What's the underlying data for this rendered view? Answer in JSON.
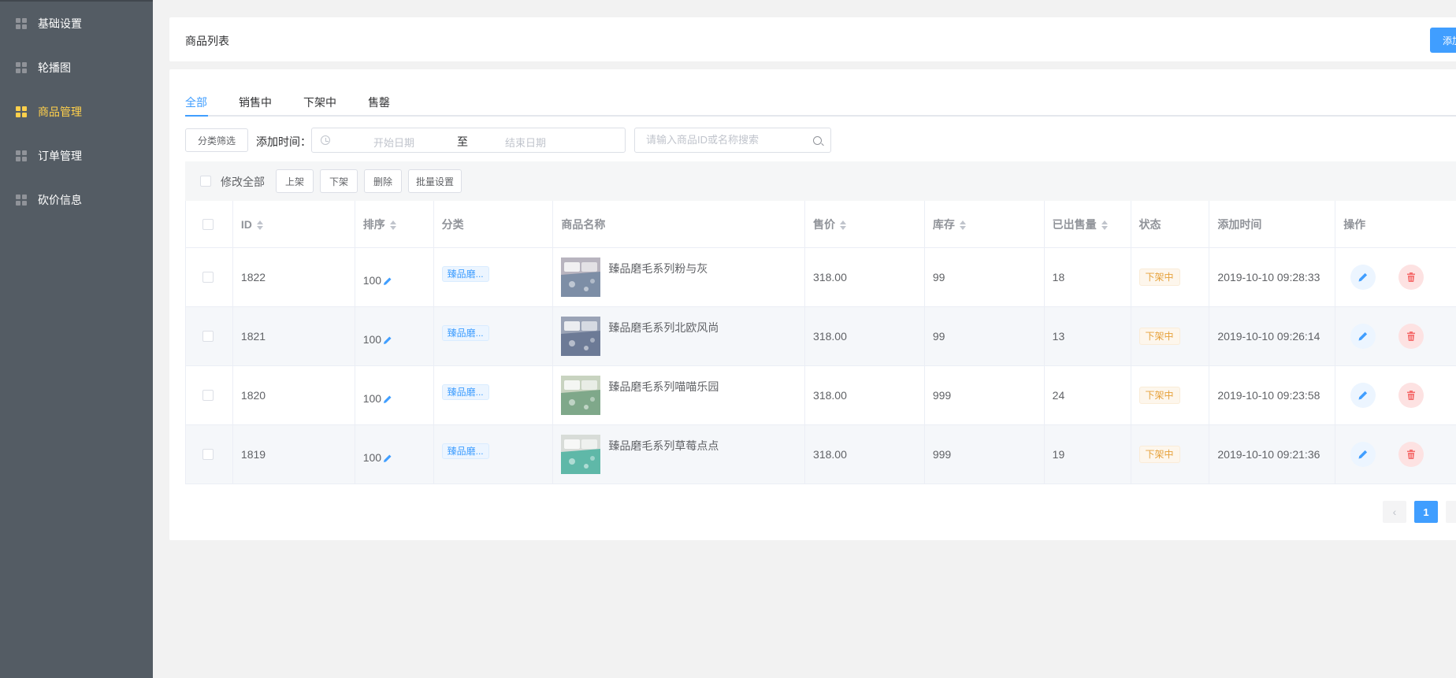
{
  "sidebar": {
    "items": [
      {
        "label": "基础设置",
        "icon": "grid-icon"
      },
      {
        "label": "轮播图",
        "icon": "grid-icon"
      },
      {
        "label": "商品管理",
        "icon": "grid-icon",
        "active": true
      },
      {
        "label": "订单管理",
        "icon": "grid-icon"
      },
      {
        "label": "砍价信息",
        "icon": "grid-icon"
      }
    ]
  },
  "header": {
    "title": "商品列表",
    "add_button": "添加商品"
  },
  "tabs": [
    "全部",
    "销售中",
    "下架中",
    "售罄"
  ],
  "filters": {
    "category_button": "分类筛选",
    "date_label": "添加时间：",
    "start_placeholder": "开始日期",
    "separator": "至",
    "end_placeholder": "结束日期",
    "search_placeholder": "请输入商品ID或名称搜索"
  },
  "batch": {
    "select_all_label": "修改全部",
    "buttons": [
      "上架",
      "下架",
      "删除",
      "批量设置"
    ]
  },
  "table": {
    "columns": [
      "ID",
      "排序",
      "分类",
      "商品名称",
      "售价",
      "库存",
      "已出售量",
      "状态",
      "添加时间",
      "操作"
    ],
    "rows": [
      {
        "id": "1822",
        "sort": "100",
        "category": "臻品磨...",
        "name": "臻品磨毛系列粉与灰",
        "price": "318.00",
        "stock": "99",
        "sold": "18",
        "status": "下架中",
        "time": "2019-10-10 09:28:33"
      },
      {
        "id": "1821",
        "sort": "100",
        "category": "臻品磨...",
        "name": "臻品磨毛系列北欧风尚",
        "price": "318.00",
        "stock": "99",
        "sold": "13",
        "status": "下架中",
        "time": "2019-10-10 09:26:14"
      },
      {
        "id": "1820",
        "sort": "100",
        "category": "臻品磨...",
        "name": "臻品磨毛系列喵喵乐园",
        "price": "318.00",
        "stock": "999",
        "sold": "24",
        "status": "下架中",
        "time": "2019-10-10 09:23:58"
      },
      {
        "id": "1819",
        "sort": "100",
        "category": "臻品磨...",
        "name": "臻品磨毛系列草莓点点",
        "price": "318.00",
        "stock": "999",
        "sold": "19",
        "status": "下架中",
        "time": "2019-10-10 09:21:36"
      }
    ]
  },
  "pagination": {
    "current_page": "1",
    "prev_symbol": "‹"
  },
  "colors": {
    "sidebar_bg": "#545c64",
    "active_menu": "#ffd04b",
    "primary": "#409eff",
    "warning": "#e6a23c",
    "danger": "#f56c6c"
  }
}
